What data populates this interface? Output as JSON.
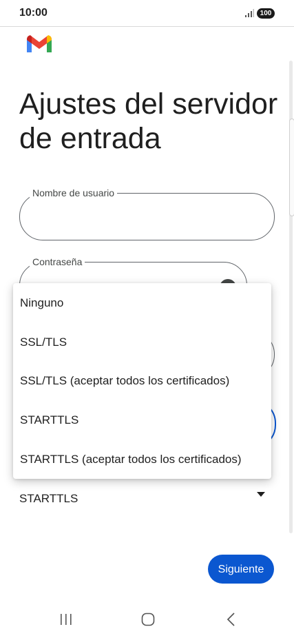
{
  "status_bar": {
    "time": "10:00",
    "battery": "100"
  },
  "app": {
    "logo": "gmail-logo"
  },
  "page": {
    "title": "Ajustes del servidor de entrada"
  },
  "form": {
    "username": {
      "label": "Nombre de usuario",
      "value": ""
    },
    "password": {
      "label": "Contraseña",
      "value": ""
    },
    "security": {
      "selected": "STARTTLS"
    }
  },
  "dropdown": {
    "options": [
      "Ninguno",
      "SSL/TLS",
      "SSL/TLS (aceptar todos los certificados)",
      "STARTTLS",
      "STARTTLS (aceptar todos los certificados)"
    ]
  },
  "actions": {
    "next_label": "Siguiente"
  },
  "nav": {
    "icons": [
      "recents-icon",
      "home-icon",
      "back-icon"
    ]
  },
  "colors": {
    "accent": "#0b57d0",
    "gmail_red": "#ea4335",
    "gmail_blue": "#4285f4",
    "gmail_green": "#34a853",
    "gmail_yellow": "#fbbc04"
  }
}
